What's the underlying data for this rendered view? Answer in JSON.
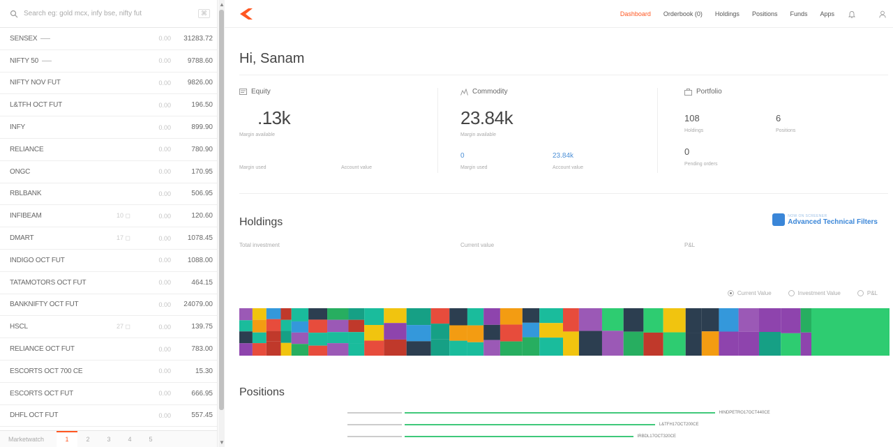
{
  "search": {
    "placeholder": "Search eg: gold mcx, infy bse, nifty fut",
    "shortcut": "⌘"
  },
  "watchlist": [
    {
      "name": "SENSEX",
      "dash": true,
      "qty": "",
      "change": "0.00",
      "price": "31283.72"
    },
    {
      "name": "NIFTY 50",
      "dash": true,
      "qty": "",
      "change": "0.00",
      "price": "9788.60"
    },
    {
      "name": "NIFTY NOV FUT",
      "dash": false,
      "qty": "",
      "change": "0.00",
      "price": "9826.00"
    },
    {
      "name": "L&TFH OCT FUT",
      "dash": false,
      "qty": "",
      "change": "0.00",
      "price": "196.50"
    },
    {
      "name": "INFY",
      "dash": false,
      "qty": "",
      "change": "0.00",
      "price": "899.90"
    },
    {
      "name": "RELIANCE",
      "dash": false,
      "qty": "",
      "change": "0.00",
      "price": "780.90"
    },
    {
      "name": "ONGC",
      "dash": false,
      "qty": "",
      "change": "0.00",
      "price": "170.95"
    },
    {
      "name": "RBLBANK",
      "dash": false,
      "qty": "",
      "change": "0.00",
      "price": "506.95"
    },
    {
      "name": "INFIBEAM",
      "dash": false,
      "qty": "10 ◻",
      "change": "0.00",
      "price": "120.60"
    },
    {
      "name": "DMART",
      "dash": false,
      "qty": "17 ◻",
      "change": "0.00",
      "price": "1078.45"
    },
    {
      "name": "INDIGO OCT FUT",
      "dash": false,
      "qty": "",
      "change": "0.00",
      "price": "1088.00"
    },
    {
      "name": "TATAMOTORS OCT FUT",
      "dash": false,
      "qty": "",
      "change": "0.00",
      "price": "464.15"
    },
    {
      "name": "BANKNIFTY OCT FUT",
      "dash": false,
      "qty": "",
      "change": "0.00",
      "price": "24079.00"
    },
    {
      "name": "HSCL",
      "dash": false,
      "qty": "27 ◻",
      "change": "0.00",
      "price": "139.75"
    },
    {
      "name": "RELIANCE OCT FUT",
      "dash": false,
      "qty": "",
      "change": "0.00",
      "price": "783.00"
    },
    {
      "name": "ESCORTS OCT 700 CE",
      "dash": false,
      "qty": "",
      "change": "0.00",
      "price": "15.30"
    },
    {
      "name": "ESCORTS OCT FUT",
      "dash": false,
      "qty": "",
      "change": "0.00",
      "price": "666.95"
    },
    {
      "name": "DHFL OCT FUT",
      "dash": false,
      "qty": "",
      "change": "0.00",
      "price": "557.45"
    }
  ],
  "footer": {
    "label": "Marketwatch",
    "tabs": [
      "1",
      "2",
      "3",
      "4",
      "5"
    ],
    "active_tab": 0
  },
  "nav": {
    "links": [
      "Dashboard",
      "Orderbook (0)",
      "Holdings",
      "Positions",
      "Funds",
      "Apps"
    ],
    "active": 0,
    "brand_color": "#ff5722"
  },
  "greeting": "Hi, Sanam",
  "equity": {
    "title": "Equity",
    "margin_available": ".13k",
    "margin_available_label": "Margin available",
    "margin_used_label": "Margin used",
    "account_value_label": "Account value"
  },
  "commodity": {
    "title": "Commodity",
    "margin_available": "23.84k",
    "margin_available_label": "Margin available",
    "margin_used": "0",
    "margin_used_label": "Margin used",
    "account_value": "23.84k",
    "account_value_label": "Account value"
  },
  "portfolio": {
    "title": "Portfolio",
    "holdings": "108",
    "holdings_label": "Holdings",
    "positions": "6",
    "positions_label": "Positions",
    "pending_orders": "0",
    "pending_orders_label": "Pending orders"
  },
  "holdings": {
    "title": "Holdings",
    "total_investment_label": "Total investment",
    "current_value_label": "Current value",
    "pnl_label": "P&L",
    "radios": [
      "Current Value",
      "Investment Value",
      "P&L"
    ],
    "radio_selected": 0,
    "promo_pre": "NOW ON SCREENER",
    "promo_main": "Advanced Technical Filters"
  },
  "positions": {
    "title": "Positions",
    "items": [
      {
        "label": "HINDPETRO17OCT440CE",
        "grey": 0.1,
        "green": 0.57
      },
      {
        "label": "L&TFH17OCT200CE",
        "grey": 0.1,
        "green": 0.46
      },
      {
        "label": "IRBDL17OCT320CE",
        "grey": 0.1,
        "green": 0.42
      }
    ]
  },
  "treemap_palette": [
    "#2c3e50",
    "#9b59b6",
    "#e74c3c",
    "#f1c40f",
    "#2ecc71",
    "#1abc9c",
    "#3498db",
    "#f39c12",
    "#16a085",
    "#27ae60",
    "#8e44ad",
    "#c0392b"
  ],
  "treemap_final_color": "#2ecc71"
}
